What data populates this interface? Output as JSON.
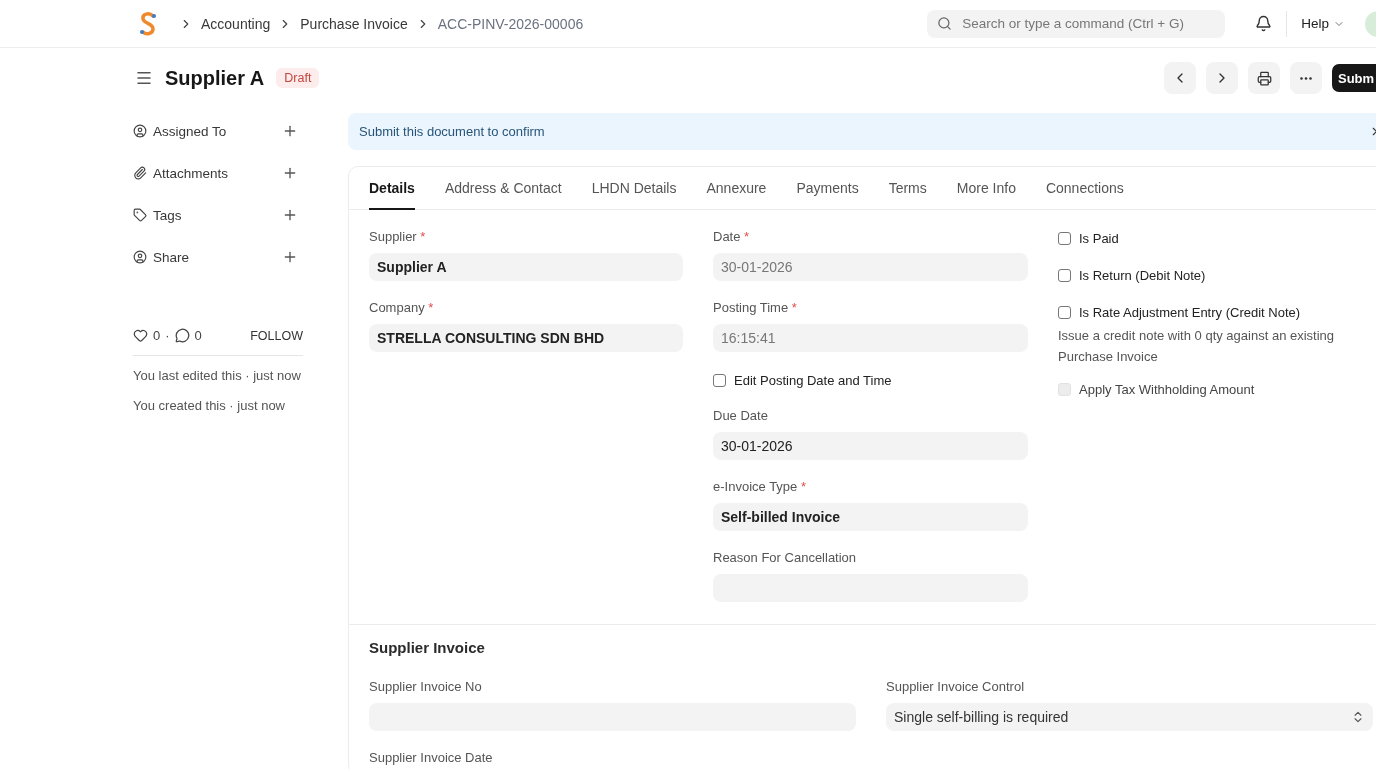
{
  "topbar": {
    "breadcrumbs": [
      "Accounting",
      "Purchase Invoice",
      "ACC-PINV-2026-00006"
    ],
    "search": {
      "placeholder": "Search or type a command (Ctrl + G)"
    },
    "help": "Help"
  },
  "header": {
    "title": "Supplier A",
    "status": "Draft",
    "primary_action": "Subm"
  },
  "sidebar": {
    "items": [
      {
        "label": "Assigned To"
      },
      {
        "label": "Attachments"
      },
      {
        "label": "Tags"
      },
      {
        "label": "Share"
      }
    ],
    "likes": "0",
    "separator": "·",
    "comments": "0",
    "follow": "FOLLOW",
    "activity": [
      "You last edited this · just now",
      "You created this · just now"
    ]
  },
  "banner": {
    "text": "Submit this document to confirm"
  },
  "tabs": [
    {
      "label": "Details",
      "selected": true
    },
    {
      "label": "Address & Contact",
      "selected": false
    },
    {
      "label": "LHDN Details",
      "selected": false
    },
    {
      "label": "Annexure",
      "selected": false
    },
    {
      "label": "Payments",
      "selected": false
    },
    {
      "label": "Terms",
      "selected": false
    },
    {
      "label": "More Info",
      "selected": false
    },
    {
      "label": "Connections",
      "selected": false
    }
  ],
  "details": {
    "columns": [
      [
        {
          "kind": "input",
          "label": "Supplier",
          "required_mark": "*",
          "value": "Supplier A",
          "link": true,
          "read_only": false
        },
        {
          "kind": "input",
          "label": "Company",
          "required_mark": "*",
          "value": "STRELLA CONSULTING SDN BHD",
          "link": true,
          "read_only": false
        }
      ],
      [
        {
          "kind": "input",
          "label": "Date",
          "required_mark": "*",
          "value": "30-01-2026",
          "link": false,
          "read_only": true
        },
        {
          "kind": "input",
          "label": "Posting Time",
          "required_mark": "*",
          "value": "16:15:41",
          "link": false,
          "read_only": true
        },
        {
          "kind": "checkbox",
          "label": "Edit Posting Date and Time",
          "checked": false,
          "disabled": false
        },
        {
          "kind": "input",
          "label": "Due Date",
          "value": "30-01-2026",
          "link": false,
          "read_only": false
        },
        {
          "kind": "input",
          "label": "e-Invoice Type",
          "required_mark": "*",
          "value": "Self-billed Invoice",
          "link": true,
          "read_only": false
        },
        {
          "kind": "input",
          "label": "Reason For Cancellation"
        }
      ],
      [
        {
          "kind": "checkbox",
          "label": "Is Paid",
          "checked": false,
          "disabled": false
        },
        {
          "kind": "checkbox",
          "label": "Is Return (Debit Note)",
          "checked": false,
          "disabled": false
        },
        {
          "kind": "checkbox",
          "label": "Is Rate Adjustment Entry (Credit Note)",
          "checked": false,
          "disabled": false
        },
        {
          "kind": "description",
          "text": "Issue a credit note with 0 qty against an existing Purchase Invoice"
        },
        {
          "kind": "checkbox",
          "label": "Apply Tax Withholding Amount",
          "checked": false,
          "disabled": true
        }
      ]
    ]
  },
  "section": {
    "title": "Supplier Invoice",
    "columns": [
      [
        {
          "kind": "input",
          "label": "Supplier Invoice No"
        },
        {
          "kind": "label",
          "label": "Supplier Invoice Date"
        }
      ],
      [
        {
          "kind": "select",
          "label": "Supplier Invoice Control",
          "value": "Single self-billing is required"
        }
      ]
    ]
  }
}
